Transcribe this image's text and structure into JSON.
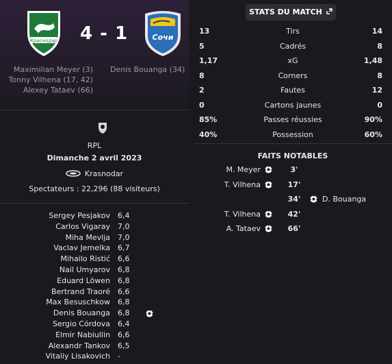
{
  "match": {
    "score": "4 - 1",
    "home_scorers": [
      "Maximilian Meyer (3)",
      "Tonny Vilhena (17, 42)",
      "Alexey Tataev (66)"
    ],
    "away_scorers": [
      "Denis Bouanga (34)"
    ],
    "home_crest_text": "Краснодар",
    "away_crest_text": "Сочи",
    "competition": "RPL",
    "date": "Dimanche 2 avril 2023",
    "stadium": "Krasnodar",
    "attendance": "Spectateurs : 22,296 (88 visiteurs)"
  },
  "players": [
    {
      "name": "Sergey Pesjakov",
      "rating": "6,4",
      "icon": ""
    },
    {
      "name": "Carlos Vigaray",
      "rating": "7,0",
      "icon": ""
    },
    {
      "name": "Miha Mevlja",
      "rating": "7,0",
      "icon": ""
    },
    {
      "name": "Vaclav Jemelka",
      "rating": "6,7",
      "icon": ""
    },
    {
      "name": "Mihailo Ristić",
      "rating": "6,6",
      "icon": ""
    },
    {
      "name": "Nail Umyarov",
      "rating": "6,8",
      "icon": ""
    },
    {
      "name": "Eduard Löwen",
      "rating": "6,8",
      "icon": ""
    },
    {
      "name": "Bertrand Traoré",
      "rating": "6,6",
      "icon": ""
    },
    {
      "name": "Max Besuschkow",
      "rating": "6,8",
      "icon": ""
    },
    {
      "name": "Denis Bouanga",
      "rating": "6,8",
      "icon": "goal-ball-icon"
    },
    {
      "name": "Sergio Córdova",
      "rating": "6,4",
      "icon": ""
    },
    {
      "name": "Elmir Nabiullin",
      "rating": "6,6",
      "icon": ""
    },
    {
      "name": "Alexandr Tankov",
      "rating": "6,5",
      "icon": ""
    },
    {
      "name": "Vitaliy Lisakovich",
      "rating": "-",
      "icon": ""
    }
  ],
  "stats_tab": {
    "label": "STATS DU MATCH",
    "icon": "expand-icon"
  },
  "stats": [
    {
      "label": "Tirs",
      "home": "13",
      "away": "14"
    },
    {
      "label": "Cadrés",
      "home": "5",
      "away": "8"
    },
    {
      "label": "xG",
      "home": "1,17",
      "away": "1,48"
    },
    {
      "label": "Corners",
      "home": "8",
      "away": "8"
    },
    {
      "label": "Fautes",
      "home": "2",
      "away": "12"
    },
    {
      "label": "Cartons jaunes",
      "home": "0",
      "away": "0"
    },
    {
      "label": "Passes réussies",
      "home": "85%",
      "away": "90%"
    },
    {
      "label": "Possession",
      "home": "40%",
      "away": "60%"
    }
  ],
  "faits": {
    "title": "FAITS NOTABLES",
    "events": [
      {
        "home": "M. Meyer",
        "minute": "3'",
        "away": ""
      },
      {
        "home": "T. Vilhena",
        "minute": "17'",
        "away": ""
      },
      {
        "home": "",
        "minute": "34'",
        "away": "D. Bouanga"
      },
      {
        "home": "T. Vilhena",
        "minute": "42'",
        "away": ""
      },
      {
        "home": "A. Tataev",
        "minute": "66'",
        "away": ""
      }
    ]
  },
  "colors": {
    "background": "#1a1a1e",
    "home_crest": "#1f7a3a",
    "away_crest": "#2a6fb8",
    "header": "#2d2038"
  }
}
